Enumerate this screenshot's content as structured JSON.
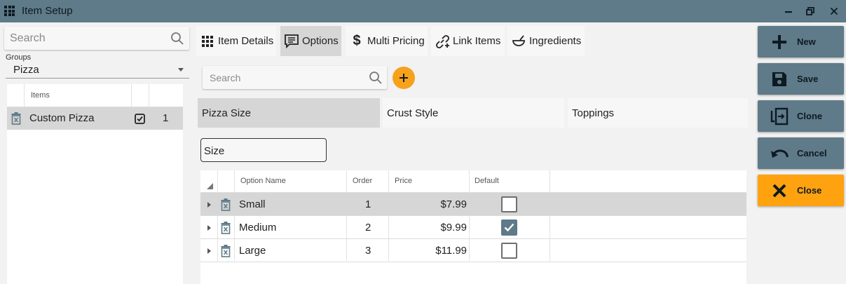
{
  "window": {
    "title": "Item Setup",
    "controls": {
      "minimize": "—",
      "restore": "❐",
      "close": "✕"
    }
  },
  "left": {
    "search_placeholder": "Search",
    "groups_label": "Groups",
    "groups_value": "Pizza",
    "items_header": "Items",
    "items": [
      {
        "name": "Custom Pizza",
        "checked": true,
        "order": "1"
      }
    ]
  },
  "tabs": [
    {
      "label": "Item Details",
      "icon": "grid-icon",
      "active": false
    },
    {
      "label": "Options",
      "icon": "options-list-icon",
      "active": true
    },
    {
      "label": "Multi Pricing",
      "icon": "dollar-icon",
      "active": false
    },
    {
      "label": "Link Items",
      "icon": "link-add-icon",
      "active": false
    },
    {
      "label": "Ingredients",
      "icon": "bowl-icon",
      "active": false
    }
  ],
  "options": {
    "search_placeholder": "Search",
    "groups": [
      {
        "label": "Pizza Size",
        "active": true
      },
      {
        "label": "Crust Style",
        "active": false
      },
      {
        "label": "Toppings",
        "active": false
      }
    ],
    "group_name_value": "Size",
    "columns": {
      "name": "Option Name",
      "order": "Order",
      "price": "Price",
      "default": "Default"
    },
    "rows": [
      {
        "name": "Small",
        "order": "1",
        "price": "$7.99",
        "default": false,
        "selected": true
      },
      {
        "name": "Medium",
        "order": "2",
        "price": "$9.99",
        "default": true,
        "selected": false
      },
      {
        "name": "Large",
        "order": "3",
        "price": "$11.99",
        "default": false,
        "selected": false
      }
    ]
  },
  "actions": [
    {
      "label": "New",
      "icon": "plus-icon"
    },
    {
      "label": "Save",
      "icon": "save-icon"
    },
    {
      "label": "Clone",
      "icon": "clone-icon"
    },
    {
      "label": "Cancel",
      "icon": "undo-icon"
    },
    {
      "label": "Close",
      "icon": "close-x-icon"
    }
  ],
  "colors": {
    "titlebar": "#5f7a88",
    "action_button": "#5f7a88",
    "close_button": "#fea20f",
    "add_button": "#f7a21b",
    "selected_row": "#d6d6d6"
  }
}
